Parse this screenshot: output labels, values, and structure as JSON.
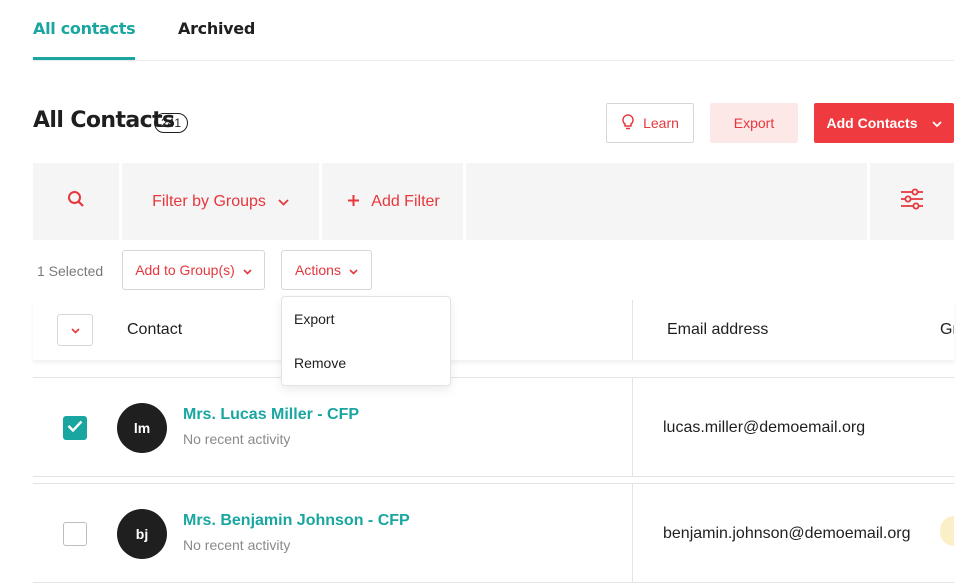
{
  "tabs": {
    "all": "All contacts",
    "archived": "Archived"
  },
  "header": {
    "title": "All Contacts",
    "count": "241"
  },
  "toolbar": {
    "learn": "Learn",
    "export": "Export",
    "add_contacts": "Add Contacts"
  },
  "filters": {
    "groups": "Filter by Groups",
    "add_filter": "Add Filter"
  },
  "selection": {
    "selected_text": "1 Selected",
    "add_to_group": "Add to Group(s)",
    "actions": "Actions"
  },
  "actions_menu": {
    "items": [
      "Export",
      "Remove"
    ]
  },
  "table": {
    "columns": {
      "contact": "Contact",
      "email": "Email address",
      "group": "Gr"
    },
    "rows": [
      {
        "initials": "lm",
        "name": "Mrs. Lucas Miller - CFP",
        "activity": "No recent activity",
        "email": "lucas.miller@demoemail.org",
        "checked": true
      },
      {
        "initials": "bj",
        "name": "Mrs. Benjamin Johnson - CFP",
        "activity": "No recent activity",
        "email": "benjamin.johnson@demoemail.org",
        "checked": false
      }
    ]
  },
  "colors": {
    "accent_teal": "#1aa6a0",
    "brand_red": "#ef3b3f",
    "export_bg": "#fde8e8",
    "filter_bg": "#f5f5f5"
  },
  "icons": [
    "search-icon",
    "chevron-down-icon",
    "plus-icon",
    "sliders-icon",
    "lightbulb-icon",
    "check-icon"
  ]
}
